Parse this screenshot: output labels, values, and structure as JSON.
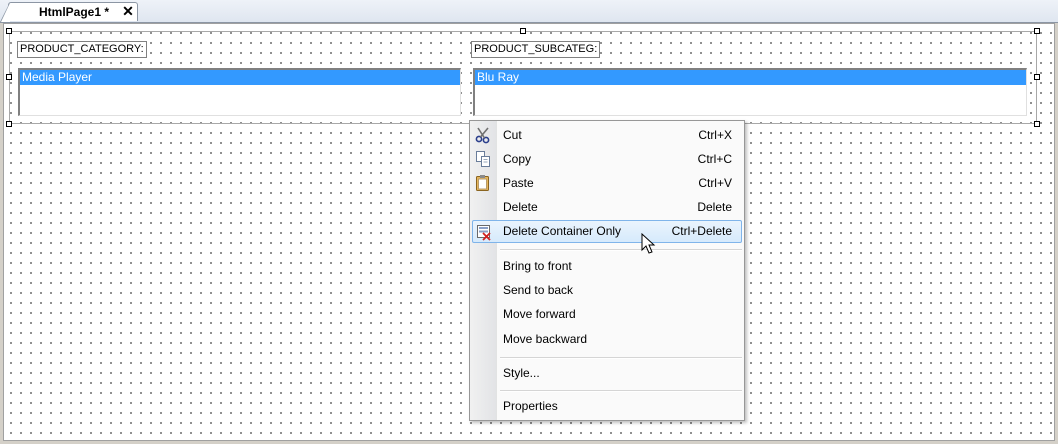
{
  "tab": {
    "label": "HtmlPage1 *",
    "close_glyph": "✕"
  },
  "form": {
    "category_label": "PRODUCT_CATEGORY:",
    "category_selected": "Media Player",
    "subcategory_label": "PRODUCT_SUBCATEG:",
    "subcategory_selected": "Blu Ray"
  },
  "context_menu": {
    "items": [
      {
        "label": "Cut",
        "shortcut": "Ctrl+X",
        "icon": "scissors-icon"
      },
      {
        "label": "Copy",
        "shortcut": "Ctrl+C",
        "icon": "copy-icon"
      },
      {
        "label": "Paste",
        "shortcut": "Ctrl+V",
        "icon": "clipboard-icon"
      },
      {
        "label": "Delete",
        "shortcut": "Delete"
      },
      {
        "label": "Delete Container Only",
        "shortcut": "Ctrl+Delete",
        "icon": "delete-container-icon",
        "highlighted": true
      },
      {
        "label": "Bring to front"
      },
      {
        "label": "Send to back"
      },
      {
        "label": "Move forward"
      },
      {
        "label": "Move backward"
      },
      {
        "label": "Style..."
      },
      {
        "label": "Properties"
      }
    ]
  },
  "colors": {
    "selection": "#3399ff",
    "menu_highlight_border": "#7fb4ea"
  }
}
